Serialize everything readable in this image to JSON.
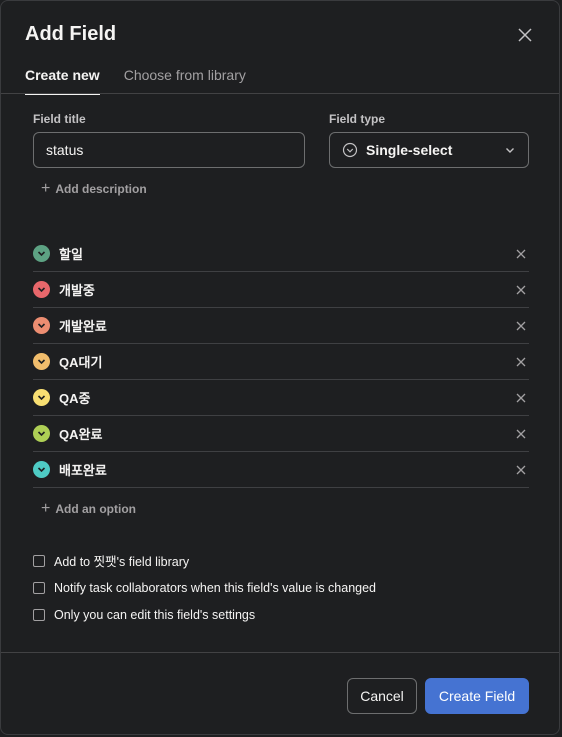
{
  "dialog": {
    "title": "Add Field",
    "close_icon": "close-icon"
  },
  "tabs": [
    {
      "label": "Create new",
      "active": true
    },
    {
      "label": "Choose from library",
      "active": false
    }
  ],
  "form": {
    "field_title_label": "Field title",
    "field_title_value": "status",
    "field_type_label": "Field type",
    "field_type_value": "Single-select",
    "field_type_icon": "single-select-icon",
    "add_description": "Add description"
  },
  "options": [
    {
      "label": "할일",
      "color": "#5da283"
    },
    {
      "label": "개발중",
      "color": "#e8676b"
    },
    {
      "label": "개발완료",
      "color": "#ec8d71"
    },
    {
      "label": "QA대기",
      "color": "#f1bd6c"
    },
    {
      "label": "QA중",
      "color": "#f8df72"
    },
    {
      "label": "QA완료",
      "color": "#aecf55"
    },
    {
      "label": "배포완료",
      "color": "#4ecbc4"
    }
  ],
  "add_option": "Add an option",
  "checkboxes": [
    {
      "label": "Add to 찟팻's field library",
      "checked": false
    },
    {
      "label": "Notify task collaborators when this field's value is changed",
      "checked": false
    },
    {
      "label": "Only you can edit this field's settings",
      "checked": false
    }
  ],
  "footer": {
    "cancel_label": "Cancel",
    "create_label": "Create Field"
  },
  "colors": {
    "accent": "#4573d2",
    "background": "#1e1f21"
  }
}
